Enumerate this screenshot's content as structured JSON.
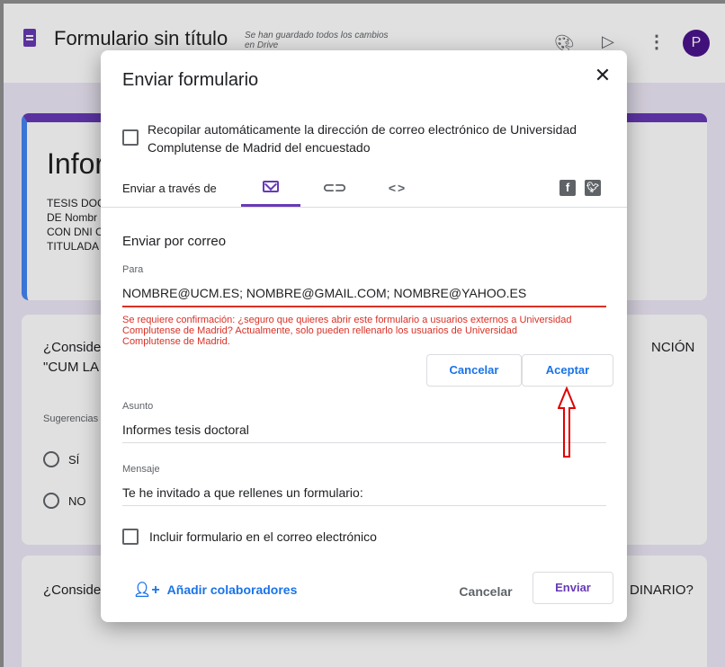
{
  "app": {
    "title": "Formulario sin título",
    "saved_status": "Se han guardado todos los cambios en Drive",
    "avatar_letter": "P"
  },
  "background": {
    "header_title_partial": "Infor",
    "header_desc_lines": [
      "TESIS DOC",
      "DE Nombr",
      "CON DNI C",
      "TITULADA"
    ],
    "q1_text_left": "¿Conside",
    "q1_text_left2": "\"CUM LA",
    "q1_text_right": "NCIÓN",
    "q1_suggestion": "Sugerencias",
    "q1_options": [
      "SÍ",
      "NO"
    ],
    "q2_text_left": "¿Conside",
    "q2_text_right": "DINARIO?"
  },
  "dialog": {
    "title": "Enviar formulario",
    "collect_email_label": "Recopilar automáticamente la dirección de correo electrónico de Universidad Complutense de Madrid del encuestado",
    "send_via_label": "Enviar a través de",
    "section_title": "Enviar por correo",
    "to_label": "Para",
    "to_value": "NOMBRE@UCM.ES; NOMBRE@GMAIL.COM; NOMBRE@YAHOO.ES",
    "error_message": "Se requiere confirmación: ¿seguro que quieres abrir este formulario a usuarios externos a Universidad Complutense de Madrid? Actualmente, solo pueden rellenarlo los usuarios de Universidad Complutense de Madrid.",
    "confirm_cancel": "Cancelar",
    "confirm_accept": "Aceptar",
    "subject_label": "Asunto",
    "subject_value": "Informes tesis doctoral",
    "message_label": "Mensaje",
    "message_value": "Te he invitado a que rellenes un formulario:",
    "include_form_label": "Incluir formulario en el correo electrónico",
    "add_collaborators": "Añadir colaboradores",
    "footer_cancel": "Cancelar",
    "footer_send": "Enviar"
  },
  "colors": {
    "accent": "#673ab7",
    "link": "#1a73e8",
    "error": "#d93025",
    "annotation_arrow": "#e00000"
  }
}
